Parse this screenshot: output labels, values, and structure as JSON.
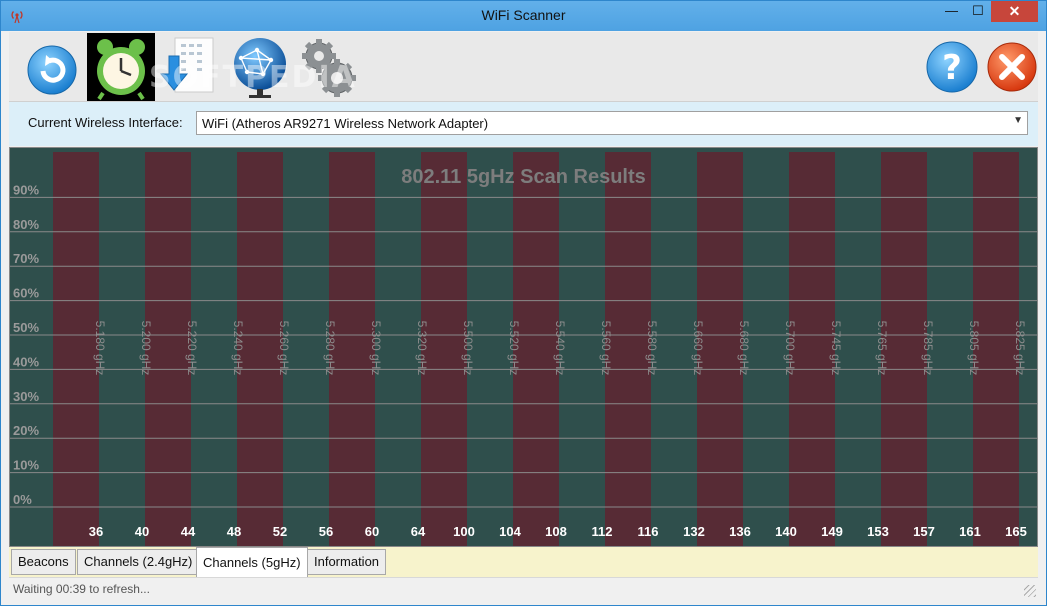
{
  "window": {
    "title": "WiFi Scanner",
    "minimize": "—",
    "maximize": "☐",
    "close": "✕"
  },
  "toolbar": {
    "watermark": "SOFTPEDIA",
    "buttons": [
      {
        "name": "refresh-button",
        "icon": "refresh-icon"
      },
      {
        "name": "schedule-button",
        "icon": "alarm-clock-icon"
      },
      {
        "name": "export-button",
        "icon": "download-arrow-icon"
      },
      {
        "name": "network-button",
        "icon": "globe-network-icon"
      },
      {
        "name": "settings-button",
        "icon": "gears-icon"
      },
      {
        "name": "help-button",
        "icon": "help-icon"
      },
      {
        "name": "exit-button",
        "icon": "close-icon"
      }
    ]
  },
  "interface": {
    "label": "Current Wireless Interface:",
    "selected": "WiFi (Atheros AR9271 Wireless Network Adapter)"
  },
  "chart_data": {
    "type": "bar",
    "title": "802.11 5gHz Scan Results",
    "y_ticks": [
      "0%",
      "10%",
      "20%",
      "30%",
      "40%",
      "50%",
      "60%",
      "70%",
      "80%",
      "90%"
    ],
    "ylim": [
      0,
      100
    ],
    "grid": true,
    "categories": [
      "36",
      "40",
      "44",
      "48",
      "52",
      "56",
      "60",
      "64",
      "100",
      "104",
      "108",
      "112",
      "116",
      "132",
      "136",
      "140",
      "149",
      "153",
      "157",
      "161",
      "165"
    ],
    "frequencies": [
      "5.180 gHz",
      "5.200 gHz",
      "5.220 gHz",
      "5.240 gHz",
      "5.260 gHz",
      "5.280 gHz",
      "5.300 gHz",
      "5.320 gHz",
      "5.500 gHz",
      "5.520 gHz",
      "5.540 gHz",
      "5.560 gHz",
      "5.580 gHz",
      "5.660 gHz",
      "5.680 gHz",
      "5.700 gHz",
      "5.745 gHz",
      "5.765 gHz",
      "5.785 gHz",
      "5.805 gHz",
      "5.825 gHz"
    ],
    "values": [],
    "colors": {
      "band_a": "#572b35",
      "band_b": "#2f4f4c",
      "grid": "#8a8a8a",
      "title": "#7d7d7d",
      "tick": "#9a9a9a",
      "channel_label": "#ffffff"
    }
  },
  "tabs": [
    {
      "label": "Beacons",
      "active": false
    },
    {
      "label": "Channels (2.4gHz)",
      "active": false
    },
    {
      "label": "Channels (5gHz)",
      "active": true
    },
    {
      "label": "Information",
      "active": false
    }
  ],
  "status": {
    "text": "Waiting 00:39 to refresh..."
  }
}
